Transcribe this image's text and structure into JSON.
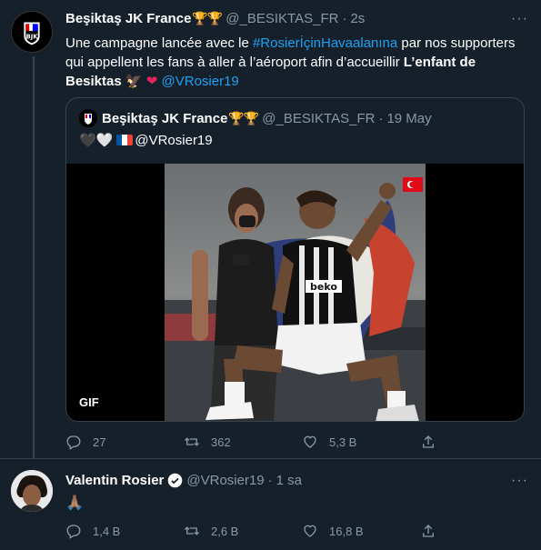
{
  "tweet1": {
    "display_name": "Beşiktaş JK France",
    "trophies": "🏆🏆",
    "handle": "@_BESIKTAS_FR",
    "dot": "·",
    "time": "2s",
    "text_part1": "Une campagne lancée avec le ",
    "hashtag": "#RosierİçinHavaalanına",
    "text_part2": " par nos supporters qui appellent les fans à aller à l’aéroport afin d’accueillir ",
    "bold_text": "L’enfant de Besiktas",
    "eagle": "🦅",
    "heart": "❤",
    "mention": "@VRosier19",
    "quote": {
      "display_name": "Beşiktaş JK France",
      "trophies": "🏆🏆",
      "handle": "@_BESIKTAS_FR",
      "dot": "·",
      "date": "19 May",
      "hearts": "🖤🤍",
      "mention": "@VRosier19",
      "gif_label": "GIF"
    },
    "actions": {
      "replies": "27",
      "retweets": "362",
      "likes": "5,3 B"
    }
  },
  "tweet2": {
    "display_name": "Valentin Rosier",
    "handle": "@VRosier19",
    "dot": "·",
    "time": "1 sa",
    "text": "🙏🏽",
    "actions": {
      "replies": "1,4 B",
      "retweets": "2,6 B",
      "likes": "16,8 B"
    }
  },
  "colors": {
    "background": "#15202b",
    "border": "#38444d",
    "secondary_text": "#8899a6",
    "link": "#1da1f2",
    "heart": "#e0245e"
  },
  "icons": [
    "reply-icon",
    "retweet-icon",
    "like-icon",
    "share-icon",
    "more-icon",
    "verified-icon"
  ]
}
